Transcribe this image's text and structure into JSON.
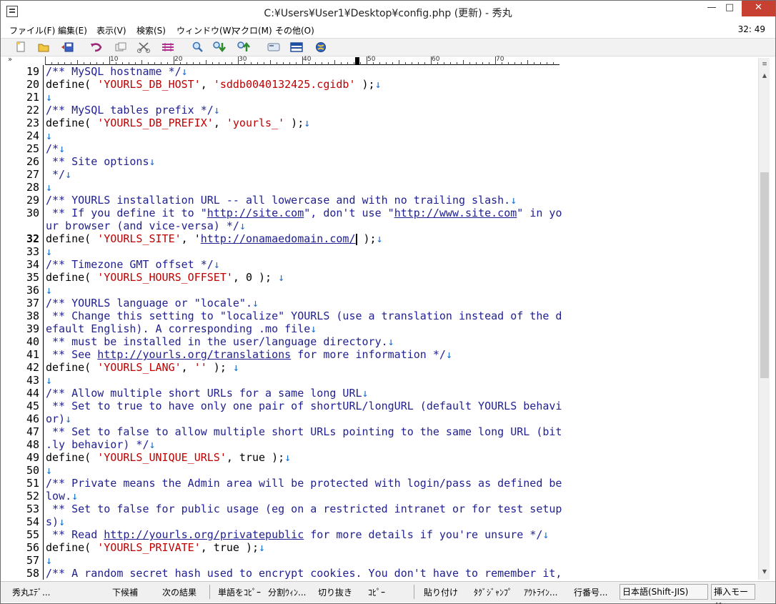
{
  "window": {
    "title": "C:¥Users¥User1¥Desktop¥config.php (更新) - 秀丸",
    "min_label": "—",
    "max_label": "□",
    "close_label": "✕"
  },
  "menu": {
    "items": [
      "ファイル(F)",
      "編集(E)",
      "表示(V)",
      "検索(S)",
      "ウィンドウ(W)",
      "マクロ(M)",
      "その他(O)"
    ],
    "clock": "32: 49"
  },
  "toolbar": {
    "icons": [
      "new-file-icon",
      "open-folder-icon",
      "save-icon",
      "undo-icon",
      "copy-icon",
      "cut-icon",
      "paste-icon",
      "search-icon",
      "search-down-icon",
      "search-up-icon",
      "grep-icon",
      "window-icon",
      "globe-icon"
    ]
  },
  "ruler": {
    "corner": "»",
    "marks": [
      "10",
      "20",
      "30",
      "40",
      "50",
      "60",
      "70"
    ]
  },
  "editor": {
    "lines": [
      {
        "n": "19",
        "segs": [
          {
            "t": "/** MySQL hostname */",
            "c": "cm"
          },
          {
            "t": "↓",
            "c": "eol"
          }
        ]
      },
      {
        "n": "20",
        "segs": [
          {
            "t": "define( ",
            "c": "kw"
          },
          {
            "t": "'YOURLS_DB_HOST'",
            "c": "str"
          },
          {
            "t": ", ",
            "c": "kw"
          },
          {
            "t": "'sddb0040132425.cgidb'",
            "c": "str"
          },
          {
            "t": " );",
            "c": "kw"
          },
          {
            "t": "↓",
            "c": "eol"
          }
        ]
      },
      {
        "n": "21",
        "segs": [
          {
            "t": "↓",
            "c": "eol"
          }
        ]
      },
      {
        "n": "22",
        "segs": [
          {
            "t": "/** MySQL tables prefix */",
            "c": "cm"
          },
          {
            "t": "↓",
            "c": "eol"
          }
        ]
      },
      {
        "n": "23",
        "segs": [
          {
            "t": "define( ",
            "c": "kw"
          },
          {
            "t": "'YOURLS_DB_PREFIX'",
            "c": "str"
          },
          {
            "t": ", ",
            "c": "kw"
          },
          {
            "t": "'yourls_'",
            "c": "str"
          },
          {
            "t": " );",
            "c": "kw"
          },
          {
            "t": "↓",
            "c": "eol"
          }
        ]
      },
      {
        "n": "24",
        "segs": [
          {
            "t": "↓",
            "c": "eol"
          }
        ]
      },
      {
        "n": "25",
        "segs": [
          {
            "t": "/*",
            "c": "cm"
          },
          {
            "t": "↓",
            "c": "eol"
          }
        ]
      },
      {
        "n": "26",
        "segs": [
          {
            "t": " ** Site options",
            "c": "cm"
          },
          {
            "t": "↓",
            "c": "eol"
          }
        ]
      },
      {
        "n": "27",
        "segs": [
          {
            "t": " */",
            "c": "cm"
          },
          {
            "t": "↓",
            "c": "eol"
          }
        ]
      },
      {
        "n": "28",
        "segs": [
          {
            "t": "↓",
            "c": "eol"
          }
        ]
      },
      {
        "n": "29",
        "segs": [
          {
            "t": "/** YOURLS installation URL -- all lowercase and with no trailing slash.",
            "c": "cm"
          },
          {
            "t": "↓",
            "c": "eol"
          }
        ]
      },
      {
        "n": "30",
        "segs": [
          {
            "t": " ** If you define it to \"",
            "c": "cm"
          },
          {
            "t": "http://site.com",
            "c": "url"
          },
          {
            "t": "\", don't use \"",
            "c": "cm"
          },
          {
            "t": "http://www.site.com",
            "c": "url"
          },
          {
            "t": "\" in yo",
            "c": "cm"
          }
        ]
      },
      {
        "n": "",
        "segs": [
          {
            "t": "ur browser (and vice-versa) */",
            "c": "cm"
          },
          {
            "t": "↓",
            "c": "eol"
          }
        ]
      },
      {
        "n": "32",
        "cursor": true,
        "segs": [
          {
            "t": "define( ",
            "c": "kw"
          },
          {
            "t": "'YOURLS_SITE'",
            "c": "str"
          },
          {
            "t": ", '",
            "c": "kw"
          },
          {
            "t": "http://onamaedomain.com/",
            "c": "url"
          },
          {
            "t": "CARET",
            "c": "caret"
          },
          {
            "t": " );",
            "c": "kw"
          },
          {
            "t": "↓",
            "c": "eol"
          }
        ]
      },
      {
        "n": "33",
        "segs": [
          {
            "t": "↓",
            "c": "eol"
          }
        ]
      },
      {
        "n": "34",
        "segs": [
          {
            "t": "/** Timezone GMT offset */",
            "c": "cm"
          },
          {
            "t": "↓",
            "c": "eol"
          }
        ]
      },
      {
        "n": "35",
        "segs": [
          {
            "t": "define( ",
            "c": "kw"
          },
          {
            "t": "'YOURLS_HOURS_OFFSET'",
            "c": "str"
          },
          {
            "t": ", 0 ); ",
            "c": "kw"
          },
          {
            "t": "↓",
            "c": "eol"
          }
        ]
      },
      {
        "n": "36",
        "segs": [
          {
            "t": "↓",
            "c": "eol"
          }
        ]
      },
      {
        "n": "37",
        "segs": [
          {
            "t": "/** YOURLS language or \"locale\".",
            "c": "cm"
          },
          {
            "t": "↓",
            "c": "eol"
          }
        ]
      },
      {
        "n": "38",
        "segs": [
          {
            "t": " ** Change this setting to \"localize\" YOURLS (use a translation instead of the d",
            "c": "cm"
          }
        ]
      },
      {
        "n": "39",
        "segs": [
          {
            "t": "efault English). A corresponding .mo file",
            "c": "cm"
          },
          {
            "t": "↓",
            "c": "eol"
          }
        ]
      },
      {
        "n": "40",
        "segs": [
          {
            "t": " ** must be installed in the user/language directory.",
            "c": "cm"
          },
          {
            "t": "↓",
            "c": "eol"
          }
        ]
      },
      {
        "n": "41",
        "segs": [
          {
            "t": " ** See ",
            "c": "cm"
          },
          {
            "t": "http://yourls.org/translations",
            "c": "url"
          },
          {
            "t": " for more information */",
            "c": "cm"
          },
          {
            "t": "↓",
            "c": "eol"
          }
        ]
      },
      {
        "n": "42",
        "segs": [
          {
            "t": "define( ",
            "c": "kw"
          },
          {
            "t": "'YOURLS_LANG'",
            "c": "str"
          },
          {
            "t": ", ",
            "c": "kw"
          },
          {
            "t": "''",
            "c": "str"
          },
          {
            "t": " ); ",
            "c": "kw"
          },
          {
            "t": "↓",
            "c": "eol"
          }
        ]
      },
      {
        "n": "43",
        "segs": [
          {
            "t": "↓",
            "c": "eol"
          }
        ]
      },
      {
        "n": "44",
        "segs": [
          {
            "t": "/** Allow multiple short URLs for a same long URL",
            "c": "cm"
          },
          {
            "t": "↓",
            "c": "eol"
          }
        ]
      },
      {
        "n": "45",
        "segs": [
          {
            "t": " ** Set to true to have only one pair of shortURL/longURL (default YOURLS behavi",
            "c": "cm"
          }
        ]
      },
      {
        "n": "46",
        "segs": [
          {
            "t": "or)",
            "c": "cm"
          },
          {
            "t": "↓",
            "c": "eol"
          }
        ]
      },
      {
        "n": "47",
        "segs": [
          {
            "t": " ** Set to false to allow multiple short URLs pointing to the same long URL (bit",
            "c": "cm"
          }
        ]
      },
      {
        "n": "48",
        "segs": [
          {
            "t": ".ly behavior) */",
            "c": "cm"
          },
          {
            "t": "↓",
            "c": "eol"
          }
        ]
      },
      {
        "n": "49",
        "segs": [
          {
            "t": "define( ",
            "c": "kw"
          },
          {
            "t": "'YOURLS_UNIQUE_URLS'",
            "c": "str"
          },
          {
            "t": ", true );",
            "c": "kw"
          },
          {
            "t": "↓",
            "c": "eol"
          }
        ]
      },
      {
        "n": "50",
        "segs": [
          {
            "t": "↓",
            "c": "eol"
          }
        ]
      },
      {
        "n": "51",
        "segs": [
          {
            "t": "/** Private means the Admin area will be protected with login/pass as defined be",
            "c": "cm"
          }
        ]
      },
      {
        "n": "52",
        "segs": [
          {
            "t": "low.",
            "c": "cm"
          },
          {
            "t": "↓",
            "c": "eol"
          }
        ]
      },
      {
        "n": "53",
        "segs": [
          {
            "t": " ** Set to false for public usage (eg on a restricted intranet or for test setup",
            "c": "cm"
          }
        ]
      },
      {
        "n": "54",
        "segs": [
          {
            "t": "s)",
            "c": "cm"
          },
          {
            "t": "↓",
            "c": "eol"
          }
        ]
      },
      {
        "n": "55",
        "segs": [
          {
            "t": " ** Read ",
            "c": "cm"
          },
          {
            "t": "http://yourls.org/privatepublic",
            "c": "url"
          },
          {
            "t": " for more details if you're unsure */",
            "c": "cm"
          },
          {
            "t": "↓",
            "c": "eol"
          }
        ]
      },
      {
        "n": "56",
        "segs": [
          {
            "t": "define( ",
            "c": "kw"
          },
          {
            "t": "'YOURLS_PRIVATE'",
            "c": "str"
          },
          {
            "t": ", true );",
            "c": "kw"
          },
          {
            "t": "↓",
            "c": "eol"
          }
        ]
      },
      {
        "n": "57",
        "segs": [
          {
            "t": "↓",
            "c": "eol"
          }
        ]
      },
      {
        "n": "58",
        "segs": [
          {
            "t": "/** A random secret hash used to encrypt cookies. You don't have to remember it,",
            "c": "cm"
          }
        ]
      }
    ]
  },
  "statusbar": {
    "fkeys": [
      "秀丸ｴﾃﾞ...",
      "下候補",
      "次の結果",
      "単語をｺﾋﾟｰ",
      "分割ｳｨﾝ...",
      "切り抜き",
      "ｺﾋﾟｰ",
      "貼り付け",
      "ﾀｸﾞｼﾞｬﾝﾌﾟ",
      "ｱｳﾄﾗｲﾝ...",
      "行番号..."
    ],
    "encoding": "日本語(Shift-JIS)",
    "mode": "挿入モード"
  }
}
